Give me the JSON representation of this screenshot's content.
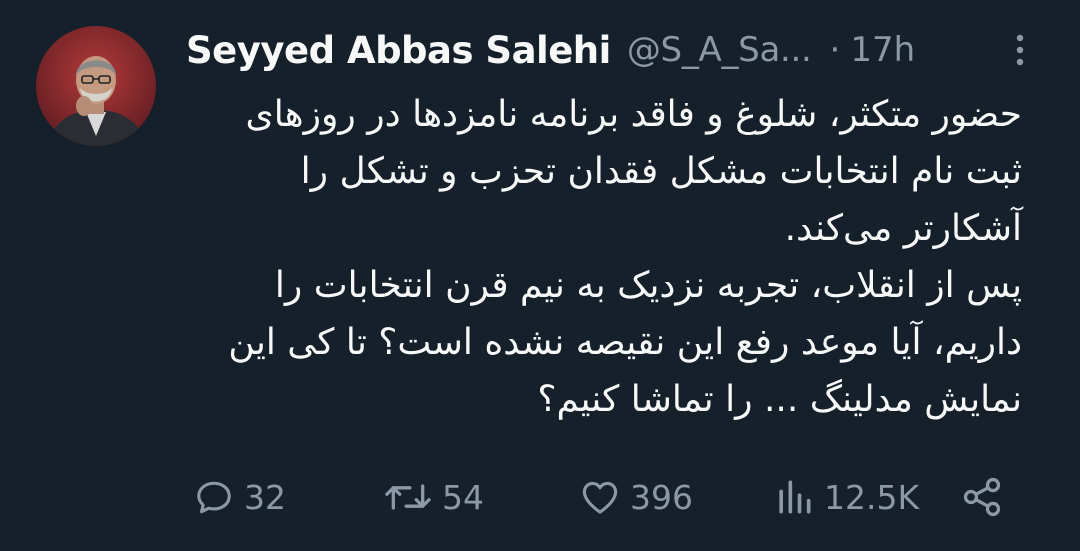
{
  "tweet": {
    "display_name": "Seyyed Abbas Salehi",
    "handle": "@S_A_Sa...",
    "separator": "·",
    "timestamp": "17h",
    "body": "حضور متکثر، شلوغ و فاقد برنامه نامزدها در روزهای ثبت نام انتخابات مشکل فقدان تحزب و تشکل را آشکارتر می‌کند.\nپس از انقلاب، تجربه نزدیک به نیم قرن انتخابات را داریم، آیا موعد رفع این نقیصه نشده است؟ تا کی این نمایش مدلینگ ... را تماشا کنیم؟"
  },
  "actions": {
    "reply_count": "32",
    "retweet_count": "54",
    "like_count": "396",
    "views_count": "12.5K"
  },
  "icons": {
    "more": "more-vertical-icon",
    "reply": "reply-icon",
    "retweet": "retweet-icon",
    "like": "heart-icon",
    "views": "views-icon",
    "share": "share-icon"
  },
  "colors": {
    "background": "#15202b",
    "primary_text": "#f7f9f9",
    "secondary_text": "#8b98a5"
  }
}
